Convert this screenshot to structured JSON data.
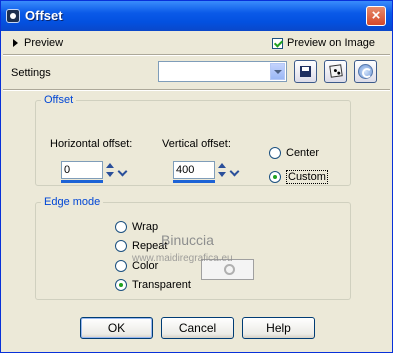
{
  "window": {
    "title": "Offset"
  },
  "icons": {
    "app": "effect-icon",
    "close": "close-icon",
    "save": "save-icon",
    "randomize": "dice-icon",
    "reset": "reset-icon"
  },
  "top": {
    "preview_label": "Preview",
    "preview_on_image_label": "Preview on Image",
    "preview_on_image_checked": true
  },
  "settings": {
    "label": "Settings",
    "value": ""
  },
  "offset": {
    "legend": "Offset",
    "horizontal_label": "Horizontal offset:",
    "horizontal_value": "0",
    "vertical_label": "Vertical offset:",
    "vertical_value": "400",
    "modes": [
      {
        "label": "Center",
        "selected": false
      },
      {
        "label": "Custom",
        "selected": true
      }
    ]
  },
  "edge_mode": {
    "legend": "Edge mode",
    "options": [
      {
        "label": "Wrap",
        "selected": false
      },
      {
        "label": "Repeat",
        "selected": false
      },
      {
        "label": "Color",
        "selected": false
      },
      {
        "label": "Transparent",
        "selected": true
      }
    ]
  },
  "watermark": {
    "name": "Binuccia",
    "url": "www.maidiregrafica.eu"
  },
  "buttons": {
    "ok": "OK",
    "cancel": "Cancel",
    "help": "Help"
  },
  "colors": {
    "title_bar": "#0a5ae8",
    "legend_text": "#0046d5",
    "dialog_bg": "#ece9d8",
    "radio_dot": "#21a121"
  }
}
